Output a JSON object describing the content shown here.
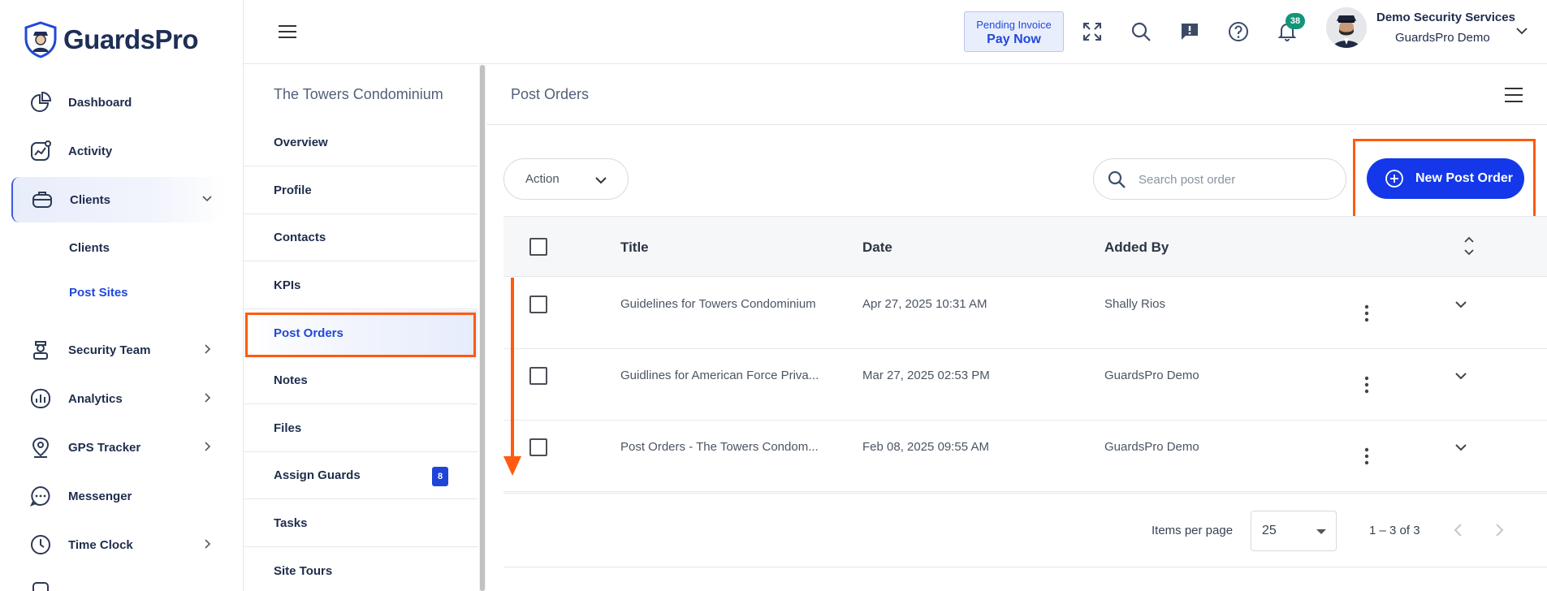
{
  "app": {
    "brand": "GuardsPro"
  },
  "sidebar": {
    "items": [
      {
        "label": "Dashboard"
      },
      {
        "label": "Activity"
      },
      {
        "label": "Clients"
      },
      {
        "label": "Security Team"
      },
      {
        "label": "Analytics"
      },
      {
        "label": "GPS Tracker"
      },
      {
        "label": "Messenger"
      },
      {
        "label": "Time Clock"
      }
    ],
    "clients_sub": [
      {
        "label": "Clients"
      },
      {
        "label": "Post Sites"
      }
    ]
  },
  "header": {
    "pending_invoice": "Pending Invoice",
    "pay_now": "Pay Now",
    "notifications_count": "38",
    "user_company": "Demo Security Services",
    "user_name": "GuardsPro Demo"
  },
  "subnav": {
    "title": "The Towers Condominium",
    "tabs": [
      {
        "label": "Overview"
      },
      {
        "label": "Profile"
      },
      {
        "label": "Contacts"
      },
      {
        "label": "KPIs"
      },
      {
        "label": "Post Orders"
      },
      {
        "label": "Notes"
      },
      {
        "label": "Files"
      },
      {
        "label": "Assign Guards",
        "badge": "8"
      },
      {
        "label": "Tasks"
      },
      {
        "label": "Site Tours"
      }
    ]
  },
  "main": {
    "title": "Post Orders",
    "action_label": "Action",
    "search_placeholder": "Search post order",
    "new_button": "New Post Order",
    "table": {
      "headers": {
        "title": "Title",
        "date": "Date",
        "added_by": "Added By"
      },
      "rows": [
        {
          "title": "Guidelines for Towers Condominium",
          "date": "Apr 27, 2025 10:31 AM",
          "added_by": "Shally Rios"
        },
        {
          "title": "Guidlines for American Force Priva...",
          "date": "Mar 27, 2025 02:53 PM",
          "added_by": "GuardsPro Demo"
        },
        {
          "title": "Post Orders - The Towers Condom...",
          "date": "Feb 08, 2025 09:55 AM",
          "added_by": "GuardsPro Demo"
        }
      ]
    },
    "paginator": {
      "items_per_page_label": "Items per page",
      "items_per_page": "25",
      "range": "1 – 3 of 3"
    }
  },
  "colors": {
    "primary": "#1438e9",
    "highlight": "#ff5a10",
    "badge_green": "#14957a"
  }
}
